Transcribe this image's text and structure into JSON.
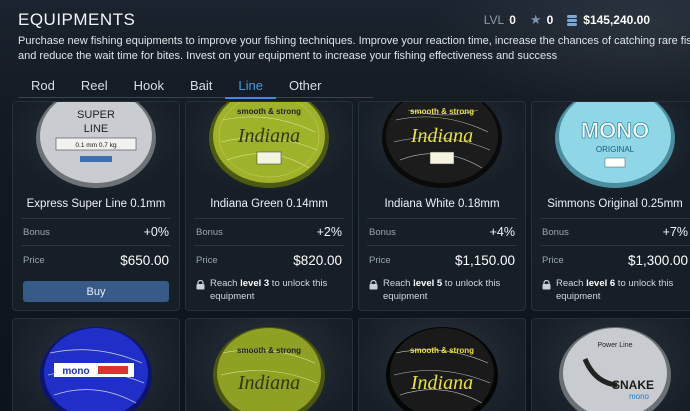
{
  "header": {
    "title": "EQUIPMENTS",
    "level_label": "LVL",
    "level_value": "0",
    "stars_value": "0",
    "money_value": "$145,240.00"
  },
  "description": {
    "line1": "Purchase new fishing equipments to improve your fishing techniques. Improve your reaction time, increase the chances of catching rare fish,",
    "line2": "and reduce the wait time for bites. Invest on your equipment to increase your fishing effectiveness and success"
  },
  "tabs": [
    {
      "label": "Rod",
      "active": false
    },
    {
      "label": "Reel",
      "active": false
    },
    {
      "label": "Hook",
      "active": false
    },
    {
      "label": "Bait",
      "active": false
    },
    {
      "label": "Line",
      "active": true
    },
    {
      "label": "Other",
      "active": false
    }
  ],
  "labels": {
    "bonus": "Bonus",
    "price": "Price",
    "buy": "Buy"
  },
  "items": [
    {
      "name": "Express Super Line 0.1mm",
      "bonus": "+0%",
      "price": "$650.00",
      "locked": false,
      "spool_color": "#c9cdd2",
      "spool_text": "SUPER",
      "spool_text2": "LINE",
      "spool_text3": "0.1 mm  0.7 kg"
    },
    {
      "name": "Indiana Green 0.14mm",
      "bonus": "+2%",
      "price": "$820.00",
      "locked": true,
      "lock_pre": "Reach ",
      "lock_level": "level 3",
      "lock_post": " to unlock this equipment",
      "spool_color": "#9fb22a",
      "spool_text": "smooth & strong",
      "spool_text2": "Indiana"
    },
    {
      "name": "Indiana White 0.18mm",
      "bonus": "+4%",
      "price": "$1,150.00",
      "locked": true,
      "lock_pre": "Reach ",
      "lock_level": "level 5",
      "lock_post": " to unlock this equipment",
      "spool_color": "#1c1c1c",
      "spool_text": "smooth & strong",
      "spool_text2": "Indiana"
    },
    {
      "name": "Simmons Original 0.25mm",
      "bonus": "+7%",
      "price": "$1,300.00",
      "locked": true,
      "lock_pre": "Reach ",
      "lock_level": "level 6",
      "lock_post": " to unlock this equipment",
      "spool_color": "#8fd6e6",
      "spool_text": "MONO",
      "spool_text2": "ORIGINAL"
    }
  ],
  "items_row2": [
    {
      "spool_color": "#1f2fc8",
      "spool_text": "mono"
    },
    {
      "spool_color": "#8fa023",
      "spool_text": "smooth & strong",
      "spool_text2": "Indiana"
    },
    {
      "spool_color": "#1a1a1a",
      "spool_text": "smooth & strong",
      "spool_text2": "Indiana"
    },
    {
      "spool_color": "#c8ccd0",
      "spool_text": "Power Line",
      "spool_text2": "SNAKE",
      "spool_text3": "mono"
    }
  ]
}
